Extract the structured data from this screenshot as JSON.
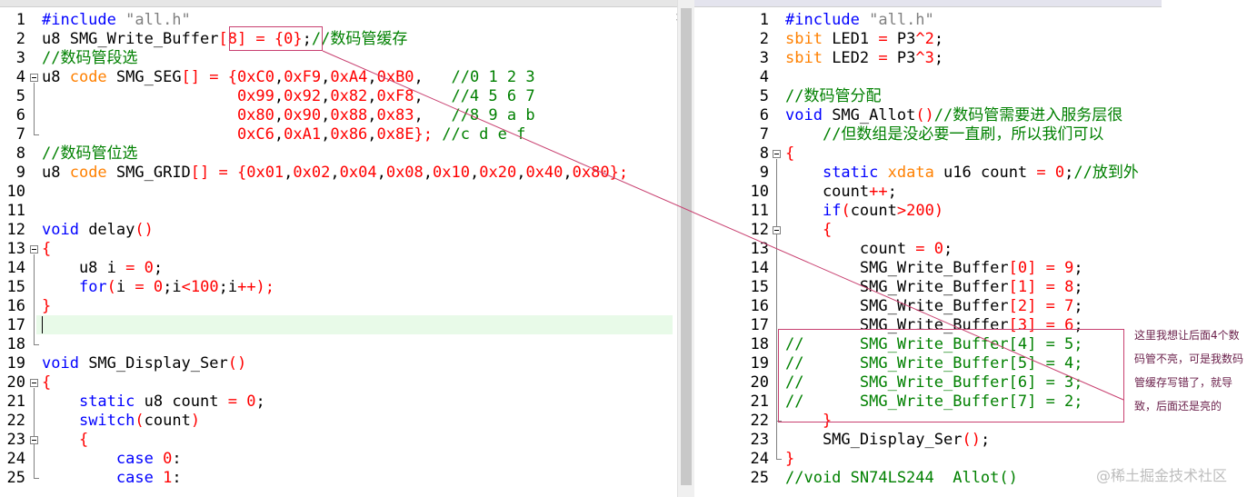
{
  "left_editor": {
    "lines": [
      {
        "num": "1",
        "tokens": [
          [
            "k",
            "#include "
          ],
          [
            "s",
            "\"all.h\""
          ]
        ]
      },
      {
        "num": "2",
        "tokens": [
          [
            "p",
            "u8 SMG_Write_Buffer"
          ],
          [
            "o",
            "[8] = {0}"
          ],
          [
            "p",
            ";"
          ],
          [
            "c",
            "//数码管缓存"
          ]
        ]
      },
      {
        "num": "3",
        "tokens": [
          [
            "c",
            "//数码管段选"
          ]
        ]
      },
      {
        "num": "4",
        "tokens": [
          [
            "p",
            "u8 "
          ],
          [
            "t",
            "code"
          ],
          [
            "p",
            " SMG_SEG"
          ],
          [
            "o",
            "[] = {"
          ],
          [
            "n",
            "0xC0"
          ],
          [
            "p",
            ","
          ],
          [
            "n",
            "0xF9"
          ],
          [
            "p",
            ","
          ],
          [
            "n",
            "0xA4"
          ],
          [
            "p",
            ","
          ],
          [
            "n",
            "0xB0"
          ],
          [
            "p",
            ",   "
          ],
          [
            "c",
            "//0 1 2 3"
          ]
        ]
      },
      {
        "num": "5",
        "tokens": [
          [
            "p",
            "                     "
          ],
          [
            "n",
            "0x99"
          ],
          [
            "p",
            ","
          ],
          [
            "n",
            "0x92"
          ],
          [
            "p",
            ","
          ],
          [
            "n",
            "0x82"
          ],
          [
            "p",
            ","
          ],
          [
            "n",
            "0xF8"
          ],
          [
            "p",
            ",   "
          ],
          [
            "c",
            "//4 5 6 7"
          ]
        ]
      },
      {
        "num": "6",
        "tokens": [
          [
            "p",
            "                     "
          ],
          [
            "n",
            "0x80"
          ],
          [
            "p",
            ","
          ],
          [
            "n",
            "0x90"
          ],
          [
            "p",
            ","
          ],
          [
            "n",
            "0x88"
          ],
          [
            "p",
            ","
          ],
          [
            "n",
            "0x83"
          ],
          [
            "p",
            ",   "
          ],
          [
            "c",
            "//8 9 a b"
          ]
        ]
      },
      {
        "num": "7",
        "tokens": [
          [
            "p",
            "                     "
          ],
          [
            "n",
            "0xC6"
          ],
          [
            "p",
            ","
          ],
          [
            "n",
            "0xA1"
          ],
          [
            "p",
            ","
          ],
          [
            "n",
            "0x86"
          ],
          [
            "p",
            ","
          ],
          [
            "n",
            "0x8E"
          ],
          [
            "o",
            "};"
          ],
          [
            "p",
            " "
          ],
          [
            "c",
            "//c d e f"
          ]
        ]
      },
      {
        "num": "8",
        "tokens": [
          [
            "c",
            "//数码管位选"
          ]
        ]
      },
      {
        "num": "9",
        "tokens": [
          [
            "p",
            "u8 "
          ],
          [
            "t",
            "code"
          ],
          [
            "p",
            " SMG_GRID"
          ],
          [
            "o",
            "[] = {"
          ],
          [
            "n",
            "0x01"
          ],
          [
            "p",
            ","
          ],
          [
            "n",
            "0x02"
          ],
          [
            "p",
            ","
          ],
          [
            "n",
            "0x04"
          ],
          [
            "p",
            ","
          ],
          [
            "n",
            "0x08"
          ],
          [
            "p",
            ","
          ],
          [
            "n",
            "0x10"
          ],
          [
            "p",
            ","
          ],
          [
            "n",
            "0x20"
          ],
          [
            "p",
            ","
          ],
          [
            "n",
            "0x40"
          ],
          [
            "p",
            ","
          ],
          [
            "n",
            "0x80"
          ],
          [
            "o",
            "};"
          ]
        ]
      },
      {
        "num": "10",
        "tokens": []
      },
      {
        "num": "11",
        "tokens": []
      },
      {
        "num": "12",
        "tokens": [
          [
            "k",
            "void"
          ],
          [
            "p",
            " delay"
          ],
          [
            "o",
            "()"
          ]
        ]
      },
      {
        "num": "13",
        "tokens": [
          [
            "o",
            "{"
          ]
        ]
      },
      {
        "num": "14",
        "tokens": [
          [
            "p",
            "    u8 i "
          ],
          [
            "o",
            "= "
          ],
          [
            "n",
            "0"
          ],
          [
            "p",
            ";"
          ]
        ]
      },
      {
        "num": "15",
        "tokens": [
          [
            "p",
            "    "
          ],
          [
            "k",
            "for"
          ],
          [
            "o",
            "("
          ],
          [
            "p",
            "i "
          ],
          [
            "o",
            "= "
          ],
          [
            "n",
            "0"
          ],
          [
            "p",
            ";i"
          ],
          [
            "o",
            "<"
          ],
          [
            "n",
            "100"
          ],
          [
            "p",
            ";i"
          ],
          [
            "o",
            "++);"
          ]
        ]
      },
      {
        "num": "16",
        "tokens": [
          [
            "o",
            "}"
          ]
        ]
      },
      {
        "num": "17",
        "tokens": []
      },
      {
        "num": "18",
        "tokens": []
      },
      {
        "num": "19",
        "tokens": [
          [
            "k",
            "void"
          ],
          [
            "p",
            " SMG_Display_Ser"
          ],
          [
            "o",
            "()"
          ]
        ]
      },
      {
        "num": "20",
        "tokens": [
          [
            "o",
            "{"
          ]
        ]
      },
      {
        "num": "21",
        "tokens": [
          [
            "p",
            "    "
          ],
          [
            "k",
            "static"
          ],
          [
            "p",
            " u8 count "
          ],
          [
            "o",
            "= "
          ],
          [
            "n",
            "0"
          ],
          [
            "p",
            ";"
          ]
        ]
      },
      {
        "num": "22",
        "tokens": [
          [
            "p",
            "    "
          ],
          [
            "k",
            "switch"
          ],
          [
            "o",
            "("
          ],
          [
            "p",
            "count"
          ],
          [
            "o",
            ")"
          ]
        ]
      },
      {
        "num": "23",
        "tokens": [
          [
            "p",
            "    "
          ],
          [
            "o",
            "{"
          ]
        ]
      },
      {
        "num": "24",
        "tokens": [
          [
            "p",
            "        "
          ],
          [
            "k",
            "case"
          ],
          [
            "p",
            " "
          ],
          [
            "n",
            "0"
          ],
          [
            "p",
            ":"
          ]
        ]
      },
      {
        "num": "25",
        "tokens": [
          [
            "p",
            "        "
          ],
          [
            "k",
            "case"
          ],
          [
            "p",
            " "
          ],
          [
            "n",
            "1"
          ],
          [
            "p",
            ":"
          ]
        ]
      }
    ]
  },
  "right_editor": {
    "lines": [
      {
        "num": "1",
        "tokens": [
          [
            "k",
            "#include "
          ],
          [
            "s",
            "\"all.h\""
          ]
        ]
      },
      {
        "num": "2",
        "tokens": [
          [
            "t",
            "sbit"
          ],
          [
            "p",
            " LED1 "
          ],
          [
            "o",
            "= "
          ],
          [
            "p",
            "P3"
          ],
          [
            "o",
            "^"
          ],
          [
            "n",
            "2"
          ],
          [
            "p",
            ";"
          ]
        ]
      },
      {
        "num": "3",
        "tokens": [
          [
            "t",
            "sbit"
          ],
          [
            "p",
            " LED2 "
          ],
          [
            "o",
            "= "
          ],
          [
            "p",
            "P3"
          ],
          [
            "o",
            "^"
          ],
          [
            "n",
            "3"
          ],
          [
            "p",
            ";"
          ]
        ]
      },
      {
        "num": "4",
        "tokens": []
      },
      {
        "num": "5",
        "tokens": [
          [
            "c",
            "//数码管分配"
          ]
        ]
      },
      {
        "num": "6",
        "tokens": [
          [
            "k",
            "void"
          ],
          [
            "p",
            " SMG_Allot"
          ],
          [
            "o",
            "()"
          ],
          [
            "c",
            "//数码管需要进入服务层很"
          ]
        ]
      },
      {
        "num": "7",
        "tokens": [
          [
            "p",
            "    "
          ],
          [
            "c",
            "//但数组是没必要一直刷，所以我们可以"
          ]
        ]
      },
      {
        "num": "8",
        "tokens": [
          [
            "o",
            "{"
          ]
        ]
      },
      {
        "num": "9",
        "tokens": [
          [
            "p",
            "    "
          ],
          [
            "k",
            "static"
          ],
          [
            "p",
            " "
          ],
          [
            "t",
            "xdata"
          ],
          [
            "p",
            " u16 count "
          ],
          [
            "o",
            "= "
          ],
          [
            "n",
            "0"
          ],
          [
            "p",
            ";"
          ],
          [
            "c",
            "//放到外"
          ]
        ]
      },
      {
        "num": "10",
        "tokens": [
          [
            "p",
            "    count"
          ],
          [
            "o",
            "++"
          ],
          [
            "p",
            ";"
          ]
        ]
      },
      {
        "num": "11",
        "tokens": [
          [
            "p",
            "    "
          ],
          [
            "k",
            "if"
          ],
          [
            "o",
            "("
          ],
          [
            "p",
            "count"
          ],
          [
            "o",
            ">"
          ],
          [
            "n",
            "200"
          ],
          [
            "o",
            ")"
          ]
        ]
      },
      {
        "num": "12",
        "tokens": [
          [
            "p",
            "    "
          ],
          [
            "o",
            "{"
          ]
        ]
      },
      {
        "num": "13",
        "tokens": [
          [
            "p",
            "        count "
          ],
          [
            "o",
            "= "
          ],
          [
            "n",
            "0"
          ],
          [
            "p",
            ";"
          ]
        ]
      },
      {
        "num": "14",
        "tokens": [
          [
            "p",
            "        SMG_Write_Buffer"
          ],
          [
            "o",
            "["
          ],
          [
            "n",
            "0"
          ],
          [
            "o",
            "] = "
          ],
          [
            "n",
            "9"
          ],
          [
            "p",
            ";"
          ]
        ]
      },
      {
        "num": "15",
        "tokens": [
          [
            "p",
            "        SMG_Write_Buffer"
          ],
          [
            "o",
            "["
          ],
          [
            "n",
            "1"
          ],
          [
            "o",
            "] = "
          ],
          [
            "n",
            "8"
          ],
          [
            "p",
            ";"
          ]
        ]
      },
      {
        "num": "16",
        "tokens": [
          [
            "p",
            "        SMG_Write_Buffer"
          ],
          [
            "o",
            "["
          ],
          [
            "n",
            "2"
          ],
          [
            "o",
            "] = "
          ],
          [
            "n",
            "7"
          ],
          [
            "p",
            ";"
          ]
        ]
      },
      {
        "num": "17",
        "tokens": [
          [
            "p",
            "        SMG_Write_Buffer"
          ],
          [
            "o",
            "["
          ],
          [
            "n",
            "3"
          ],
          [
            "o",
            "] = "
          ],
          [
            "n",
            "6"
          ],
          [
            "p",
            ";"
          ]
        ]
      },
      {
        "num": "18",
        "tokens": [
          [
            "c",
            "//      SMG_Write_Buffer[4] = 5;"
          ]
        ]
      },
      {
        "num": "19",
        "tokens": [
          [
            "c",
            "//      SMG_Write_Buffer[5] = 4;"
          ]
        ]
      },
      {
        "num": "20",
        "tokens": [
          [
            "c",
            "//      SMG_Write_Buffer[6] = 3;"
          ]
        ]
      },
      {
        "num": "21",
        "tokens": [
          [
            "c",
            "//      SMG_Write_Buffer[7] = 2;"
          ]
        ]
      },
      {
        "num": "22",
        "tokens": [
          [
            "p",
            "    "
          ],
          [
            "o",
            "}"
          ]
        ]
      },
      {
        "num": "23",
        "tokens": [
          [
            "p",
            "    SMG_Display_Ser"
          ],
          [
            "o",
            "()"
          ],
          [
            "p",
            ";"
          ]
        ]
      },
      {
        "num": "24",
        "tokens": [
          [
            "o",
            "}"
          ]
        ]
      },
      {
        "num": "25",
        "tokens": [
          [
            "c",
            "//void SN74LS244  Allot()"
          ]
        ]
      }
    ]
  },
  "annotation": {
    "note_text": "这里我想让后面4个数码管不亮，可是我数码管缓存写错了，就导致，后面还是亮的"
  },
  "watermark": {
    "text": "@稀土掘金技术社区"
  },
  "icons": {
    "close": "×",
    "scroll_up": "▲",
    "scroll_down": "▼"
  },
  "colors": {
    "keyword": "#0000ff",
    "type": "#ff8000",
    "number": "#ff0000",
    "comment": "#008000",
    "current_line": "#e8fae8",
    "annotation": "#c84070"
  }
}
